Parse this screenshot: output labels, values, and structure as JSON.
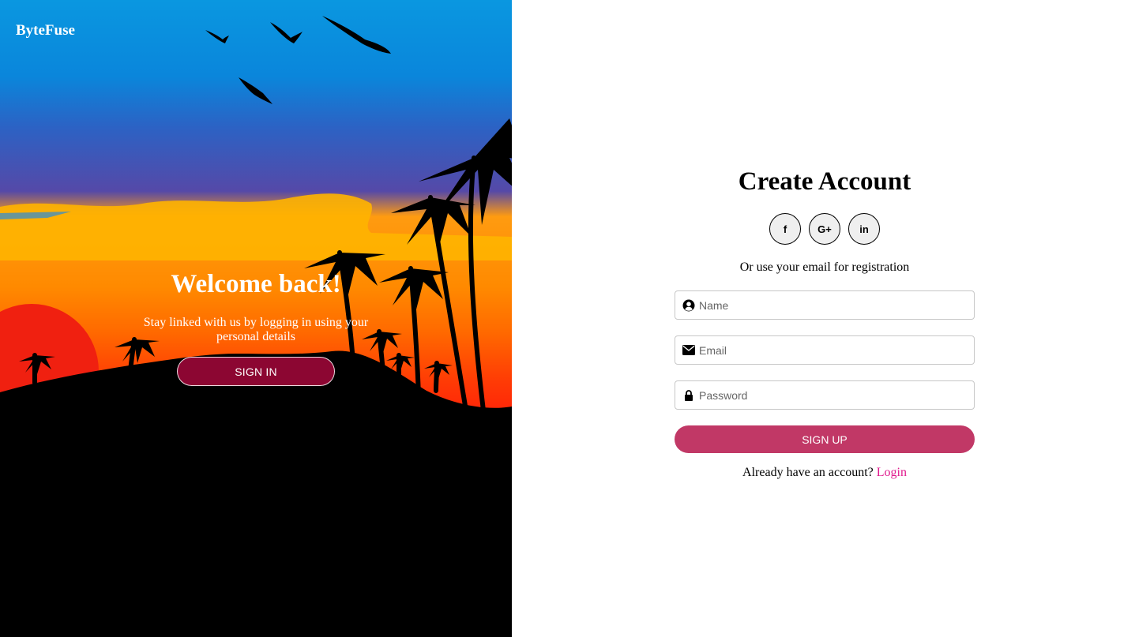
{
  "brand": "ByteFuse",
  "hero": {
    "title": "Welcome back!",
    "text": "Stay linked with us by logging in using your personal details",
    "signin_label": "SIGN IN"
  },
  "form": {
    "title": "Create Account",
    "socials": [
      {
        "label": "f",
        "icon": "facebook-icon"
      },
      {
        "label": "G+",
        "icon": "google-plus-icon"
      },
      {
        "label": "in",
        "icon": "linkedin-icon"
      }
    ],
    "subtitle": "Or use your email for registration",
    "name_placeholder": "Name",
    "email_placeholder": "Email",
    "password_placeholder": "Password",
    "signup_label": "SIGN UP",
    "already_text": "Already have an account? ",
    "login_link": "Login"
  },
  "colors": {
    "signin_button": "#8c0632",
    "signup_button": "#c13866",
    "login_link": "#e0198d"
  }
}
